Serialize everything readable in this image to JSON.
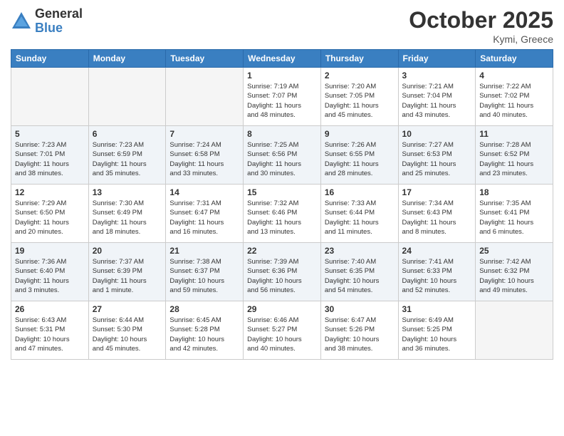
{
  "logo": {
    "general": "General",
    "blue": "Blue"
  },
  "title": "October 2025",
  "subtitle": "Kymi, Greece",
  "days_of_week": [
    "Sunday",
    "Monday",
    "Tuesday",
    "Wednesday",
    "Thursday",
    "Friday",
    "Saturday"
  ],
  "weeks": [
    [
      {
        "day": "",
        "info": ""
      },
      {
        "day": "",
        "info": ""
      },
      {
        "day": "",
        "info": ""
      },
      {
        "day": "1",
        "info": "Sunrise: 7:19 AM\nSunset: 7:07 PM\nDaylight: 11 hours\nand 48 minutes."
      },
      {
        "day": "2",
        "info": "Sunrise: 7:20 AM\nSunset: 7:05 PM\nDaylight: 11 hours\nand 45 minutes."
      },
      {
        "day": "3",
        "info": "Sunrise: 7:21 AM\nSunset: 7:04 PM\nDaylight: 11 hours\nand 43 minutes."
      },
      {
        "day": "4",
        "info": "Sunrise: 7:22 AM\nSunset: 7:02 PM\nDaylight: 11 hours\nand 40 minutes."
      }
    ],
    [
      {
        "day": "5",
        "info": "Sunrise: 7:23 AM\nSunset: 7:01 PM\nDaylight: 11 hours\nand 38 minutes."
      },
      {
        "day": "6",
        "info": "Sunrise: 7:23 AM\nSunset: 6:59 PM\nDaylight: 11 hours\nand 35 minutes."
      },
      {
        "day": "7",
        "info": "Sunrise: 7:24 AM\nSunset: 6:58 PM\nDaylight: 11 hours\nand 33 minutes."
      },
      {
        "day": "8",
        "info": "Sunrise: 7:25 AM\nSunset: 6:56 PM\nDaylight: 11 hours\nand 30 minutes."
      },
      {
        "day": "9",
        "info": "Sunrise: 7:26 AM\nSunset: 6:55 PM\nDaylight: 11 hours\nand 28 minutes."
      },
      {
        "day": "10",
        "info": "Sunrise: 7:27 AM\nSunset: 6:53 PM\nDaylight: 11 hours\nand 25 minutes."
      },
      {
        "day": "11",
        "info": "Sunrise: 7:28 AM\nSunset: 6:52 PM\nDaylight: 11 hours\nand 23 minutes."
      }
    ],
    [
      {
        "day": "12",
        "info": "Sunrise: 7:29 AM\nSunset: 6:50 PM\nDaylight: 11 hours\nand 20 minutes."
      },
      {
        "day": "13",
        "info": "Sunrise: 7:30 AM\nSunset: 6:49 PM\nDaylight: 11 hours\nand 18 minutes."
      },
      {
        "day": "14",
        "info": "Sunrise: 7:31 AM\nSunset: 6:47 PM\nDaylight: 11 hours\nand 16 minutes."
      },
      {
        "day": "15",
        "info": "Sunrise: 7:32 AM\nSunset: 6:46 PM\nDaylight: 11 hours\nand 13 minutes."
      },
      {
        "day": "16",
        "info": "Sunrise: 7:33 AM\nSunset: 6:44 PM\nDaylight: 11 hours\nand 11 minutes."
      },
      {
        "day": "17",
        "info": "Sunrise: 7:34 AM\nSunset: 6:43 PM\nDaylight: 11 hours\nand 8 minutes."
      },
      {
        "day": "18",
        "info": "Sunrise: 7:35 AM\nSunset: 6:41 PM\nDaylight: 11 hours\nand 6 minutes."
      }
    ],
    [
      {
        "day": "19",
        "info": "Sunrise: 7:36 AM\nSunset: 6:40 PM\nDaylight: 11 hours\nand 3 minutes."
      },
      {
        "day": "20",
        "info": "Sunrise: 7:37 AM\nSunset: 6:39 PM\nDaylight: 11 hours\nand 1 minute."
      },
      {
        "day": "21",
        "info": "Sunrise: 7:38 AM\nSunset: 6:37 PM\nDaylight: 10 hours\nand 59 minutes."
      },
      {
        "day": "22",
        "info": "Sunrise: 7:39 AM\nSunset: 6:36 PM\nDaylight: 10 hours\nand 56 minutes."
      },
      {
        "day": "23",
        "info": "Sunrise: 7:40 AM\nSunset: 6:35 PM\nDaylight: 10 hours\nand 54 minutes."
      },
      {
        "day": "24",
        "info": "Sunrise: 7:41 AM\nSunset: 6:33 PM\nDaylight: 10 hours\nand 52 minutes."
      },
      {
        "day": "25",
        "info": "Sunrise: 7:42 AM\nSunset: 6:32 PM\nDaylight: 10 hours\nand 49 minutes."
      }
    ],
    [
      {
        "day": "26",
        "info": "Sunrise: 6:43 AM\nSunset: 5:31 PM\nDaylight: 10 hours\nand 47 minutes."
      },
      {
        "day": "27",
        "info": "Sunrise: 6:44 AM\nSunset: 5:30 PM\nDaylight: 10 hours\nand 45 minutes."
      },
      {
        "day": "28",
        "info": "Sunrise: 6:45 AM\nSunset: 5:28 PM\nDaylight: 10 hours\nand 42 minutes."
      },
      {
        "day": "29",
        "info": "Sunrise: 6:46 AM\nSunset: 5:27 PM\nDaylight: 10 hours\nand 40 minutes."
      },
      {
        "day": "30",
        "info": "Sunrise: 6:47 AM\nSunset: 5:26 PM\nDaylight: 10 hours\nand 38 minutes."
      },
      {
        "day": "31",
        "info": "Sunrise: 6:49 AM\nSunset: 5:25 PM\nDaylight: 10 hours\nand 36 minutes."
      },
      {
        "day": "",
        "info": ""
      }
    ]
  ]
}
